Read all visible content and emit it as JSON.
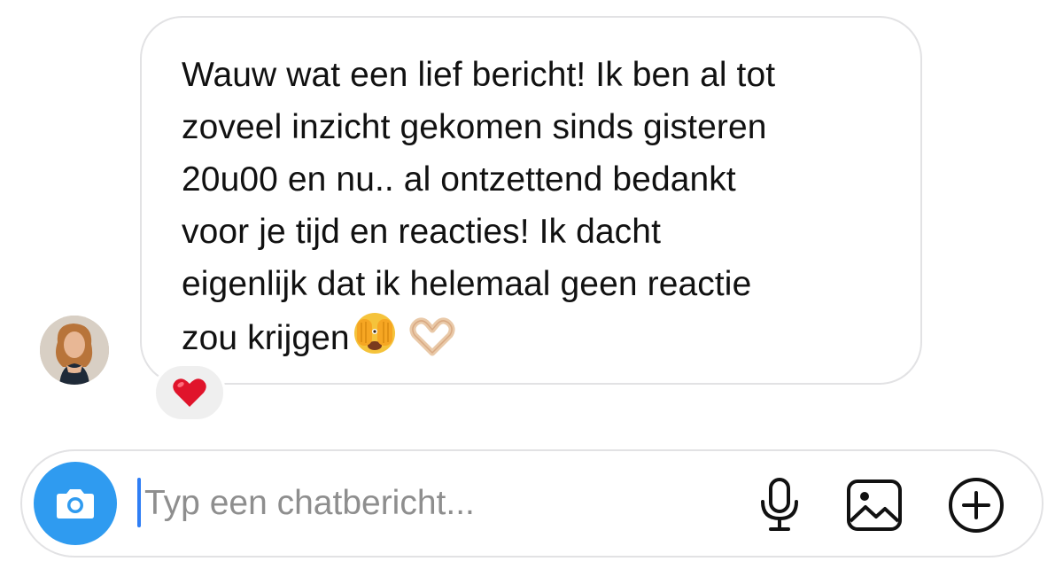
{
  "message": {
    "lines": [
      "Wauw wat een lief bericht! Ik ben al tot",
      "zoveel inzicht gekomen sinds gisteren",
      "20u00 en nu.. al ontzettend bedankt",
      "voor je tijd en reacties! Ik dacht",
      "eigenlijk dat ik helemaal geen reactie",
      "zou krijgen"
    ],
    "trailing_emojis": [
      "face-with-peeking-eye",
      "heart-hands"
    ],
    "reaction": "heart"
  },
  "composer": {
    "placeholder": "Typ een chatbericht...",
    "value": "",
    "buttons": [
      "camera-icon",
      "microphone-icon",
      "image-icon",
      "plus-circle-icon"
    ]
  },
  "colors": {
    "accent": "#2f9bf0",
    "caret": "#2f7ef5",
    "bubble_border": "#e2e2e4",
    "reaction_bg": "#efefef",
    "heart": "#e0142b"
  }
}
